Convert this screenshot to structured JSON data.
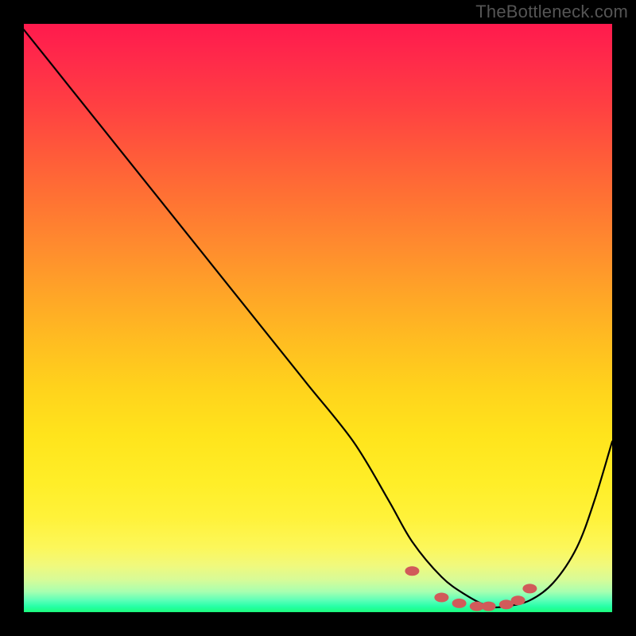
{
  "watermark": "TheBottleneck.com",
  "chart_data": {
    "type": "line",
    "title": "",
    "xlabel": "",
    "ylabel": "",
    "xlim": [
      0,
      100
    ],
    "ylim": [
      0,
      100
    ],
    "curve": {
      "name": "bottleneck-curve",
      "x": [
        0,
        8,
        16,
        24,
        32,
        40,
        48,
        56,
        62,
        66,
        71,
        75,
        79,
        82,
        86,
        90,
        94,
        97,
        100
      ],
      "y": [
        99,
        89,
        79,
        69,
        59,
        49,
        39,
        29,
        19,
        12,
        6,
        3,
        1,
        1,
        2,
        5,
        11,
        19,
        29
      ]
    },
    "highlight_points": {
      "name": "bottom-dots",
      "color": "#d15a5a",
      "x": [
        66,
        71,
        74,
        77,
        79,
        82,
        84,
        86
      ],
      "y": [
        7,
        2.5,
        1.5,
        1,
        1,
        1.3,
        2,
        4
      ]
    }
  }
}
